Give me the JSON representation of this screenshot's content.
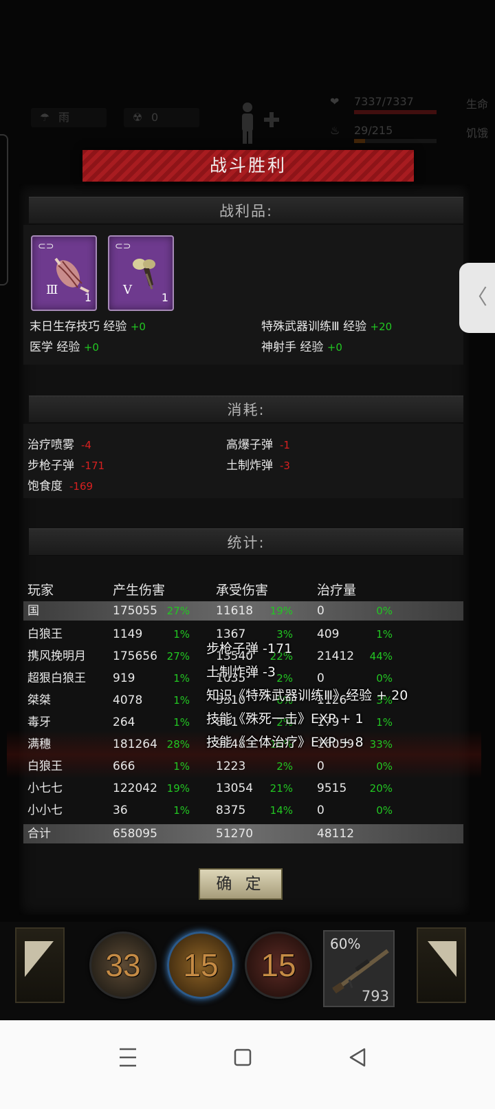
{
  "hud": {
    "weather_icon": "rain-icon",
    "weather": "雨",
    "radiation_icon": "radiation-icon",
    "radiation": "0",
    "life_value": "7337/7337",
    "life_label": "生命",
    "hunger_value": "29/215",
    "hunger_label": "饥饿",
    "life_fraction": 1.0,
    "hunger_fraction": 0.13
  },
  "banner": {
    "title": "战斗胜利"
  },
  "loot": {
    "header": "战利品:",
    "items": [
      {
        "name": "muscle-item",
        "tier": "Ⅲ",
        "count": "1"
      },
      {
        "name": "fang-item",
        "tier": "Ⅴ",
        "count": "1"
      }
    ],
    "exp": [
      {
        "label": "末日生存技巧 经验",
        "delta": "+0"
      },
      {
        "label": "特殊武器训练Ⅲ 经验",
        "delta": "+20"
      },
      {
        "label": "医学 经验",
        "delta": "+0"
      },
      {
        "label": "神射手 经验",
        "delta": "+0"
      }
    ]
  },
  "consumption": {
    "header": "消耗:",
    "items": [
      {
        "label": "治疗喷雾",
        "delta": "-4"
      },
      {
        "label": "高爆子弹",
        "delta": "-1"
      },
      {
        "label": "步枪子弹",
        "delta": "-171"
      },
      {
        "label": "土制炸弹",
        "delta": "-3"
      },
      {
        "label": "饱食度",
        "delta": "-169"
      }
    ]
  },
  "stats": {
    "header": "统计:",
    "columns": [
      "玩家",
      "产生伤害",
      "承受伤害",
      "治疗量"
    ],
    "rows": [
      {
        "player": "国",
        "dmg": "175055",
        "dmg_pct": "27%",
        "taken": "11618",
        "taken_pct": "19%",
        "heal": "0",
        "heal_pct": "0%"
      },
      {
        "player": "白狼王",
        "dmg": "1149",
        "dmg_pct": "1%",
        "taken": "1367",
        "taken_pct": "3%",
        "heal": "409",
        "heal_pct": "1%"
      },
      {
        "player": "携风挽明月",
        "dmg": "175656",
        "dmg_pct": "27%",
        "taken": "13540",
        "taken_pct": "22%",
        "heal": "21412",
        "heal_pct": "44%"
      },
      {
        "player": "超狠白狼王",
        "dmg": "919",
        "dmg_pct": "1%",
        "taken": "1035",
        "taken_pct": "2%",
        "heal": "0",
        "heal_pct": "0%"
      },
      {
        "player": "桀桀",
        "dmg": "4078",
        "dmg_pct": "1%",
        "taken": "3310",
        "taken_pct": "6%",
        "heal": "1126",
        "heal_pct": "3%"
      },
      {
        "player": "毒牙",
        "dmg": "264",
        "dmg_pct": "1%",
        "taken": "801",
        "taken_pct": "2%",
        "heal": "179",
        "heal_pct": "1%"
      },
      {
        "player": "满穗",
        "dmg": "181264",
        "dmg_pct": "28%",
        "taken": "9748",
        "taken_pct": "16%",
        "heal": "16059",
        "heal_pct": "33%"
      },
      {
        "player": "白狼王",
        "dmg": "666",
        "dmg_pct": "1%",
        "taken": "1223",
        "taken_pct": "2%",
        "heal": "0",
        "heal_pct": "0%"
      },
      {
        "player": "小七七",
        "dmg": "122042",
        "dmg_pct": "19%",
        "taken": "13054",
        "taken_pct": "21%",
        "heal": "9515",
        "heal_pct": "20%"
      },
      {
        "player": "小小七",
        "dmg": "36",
        "dmg_pct": "1%",
        "taken": "8375",
        "taken_pct": "14%",
        "heal": "0",
        "heal_pct": "0%"
      }
    ],
    "total": {
      "label": "合计",
      "dmg": "658095",
      "taken": "51270",
      "heal": "48112"
    }
  },
  "float_log": [
    "步枪子弹 -171",
    "土制炸弹 -3",
    "知识《特殊武器训练Ⅲ》经验 + 20",
    "技能《殊死一击》EXP + 1",
    "技能《全体治疗》EXP + 8"
  ],
  "confirm_label": "确 定",
  "bottom": {
    "skills": [
      {
        "name": "heal-skill",
        "cooldown": "33"
      },
      {
        "name": "bullet-skill",
        "cooldown": "15"
      },
      {
        "name": "strike-skill",
        "cooldown": "15"
      }
    ],
    "weapon": {
      "name": "sniper-rifle-icon",
      "durability": "60%",
      "ammo": "793"
    }
  },
  "colors": {
    "gain": "#22c722",
    "loss": "#d82020",
    "banner": "#a81c20",
    "item_slot": "#6e3a8e"
  }
}
